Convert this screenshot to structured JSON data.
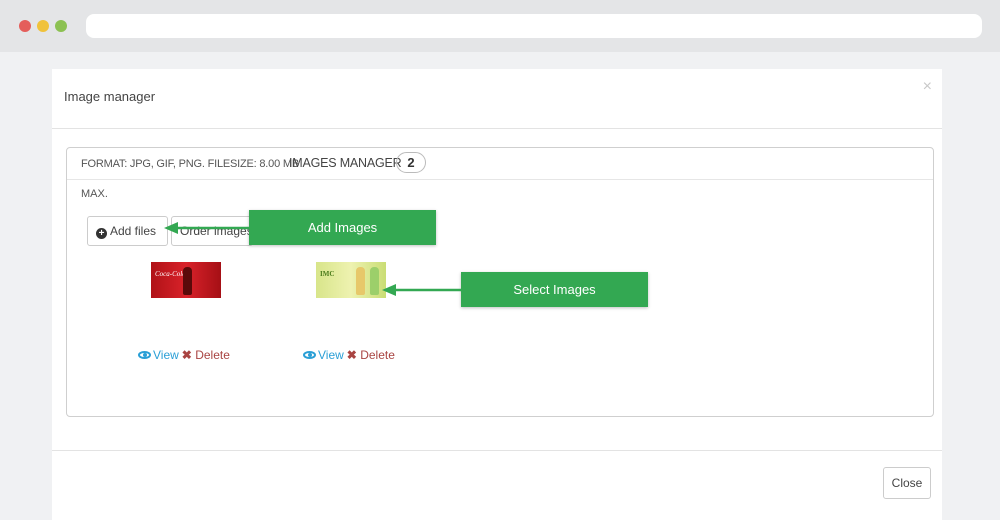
{
  "modal": {
    "title": "Image manager",
    "close_icon": "×",
    "format_info": "FORMAT: JPG, GIF, PNG. FILESIZE: 8.00 MB",
    "max_info": "MAX.",
    "manager_label": "IMAGES MANAGER",
    "image_count": "2",
    "add_files_label": "Add files",
    "order_images_label": "Order images",
    "images": [
      {
        "title": "Coca-Cola",
        "view_label": "View",
        "delete_label": "Delete"
      },
      {
        "title": "IMC",
        "view_label": "View",
        "delete_label": "Delete"
      }
    ],
    "close_button_label": "Close"
  },
  "callouts": {
    "add_images": "Add Images",
    "select_images": "Select Images"
  },
  "colors": {
    "callout": "#33a852",
    "link": "#2a9fd6",
    "delete": "#a94442"
  }
}
